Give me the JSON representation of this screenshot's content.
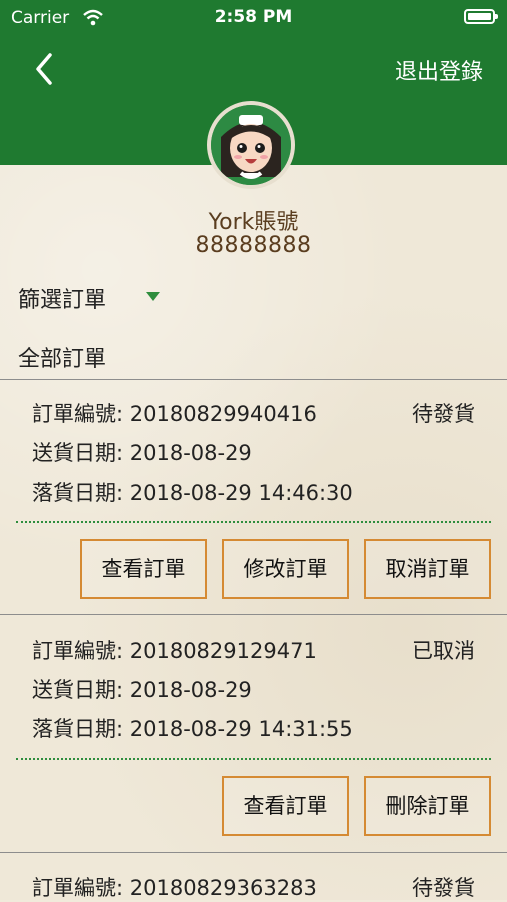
{
  "status_bar": {
    "carrier": "Carrier",
    "time": "2:58 PM"
  },
  "header": {
    "logout": "退出登錄"
  },
  "account": {
    "name": "York賬號",
    "number": "88888888"
  },
  "filter": {
    "label": "篩選訂單",
    "selected": "全部訂單"
  },
  "orders": [
    {
      "order_no": "訂單編號: 20180829940416",
      "delivery_date": "送貨日期:  2018-08-29",
      "placed_date": "落貨日期: 2018-08-29 14:46:30",
      "status": "待發貨",
      "buttons": [
        "查看訂單",
        "修改訂單",
        "取消訂單"
      ]
    },
    {
      "order_no": "訂單編號: 20180829129471",
      "delivery_date": "送貨日期:  2018-08-29",
      "placed_date": "落貨日期: 2018-08-29 14:31:55",
      "status": "已取消",
      "buttons": [
        "查看訂單",
        "刪除訂單"
      ]
    },
    {
      "order_no": "訂單編號: 20180829363283",
      "status": "待發貨"
    }
  ],
  "colors": {
    "header_green": "#1f7a30",
    "button_border": "#d58a33",
    "dotted_green": "#2e8d3d",
    "brown_text": "#5a3d1f"
  }
}
